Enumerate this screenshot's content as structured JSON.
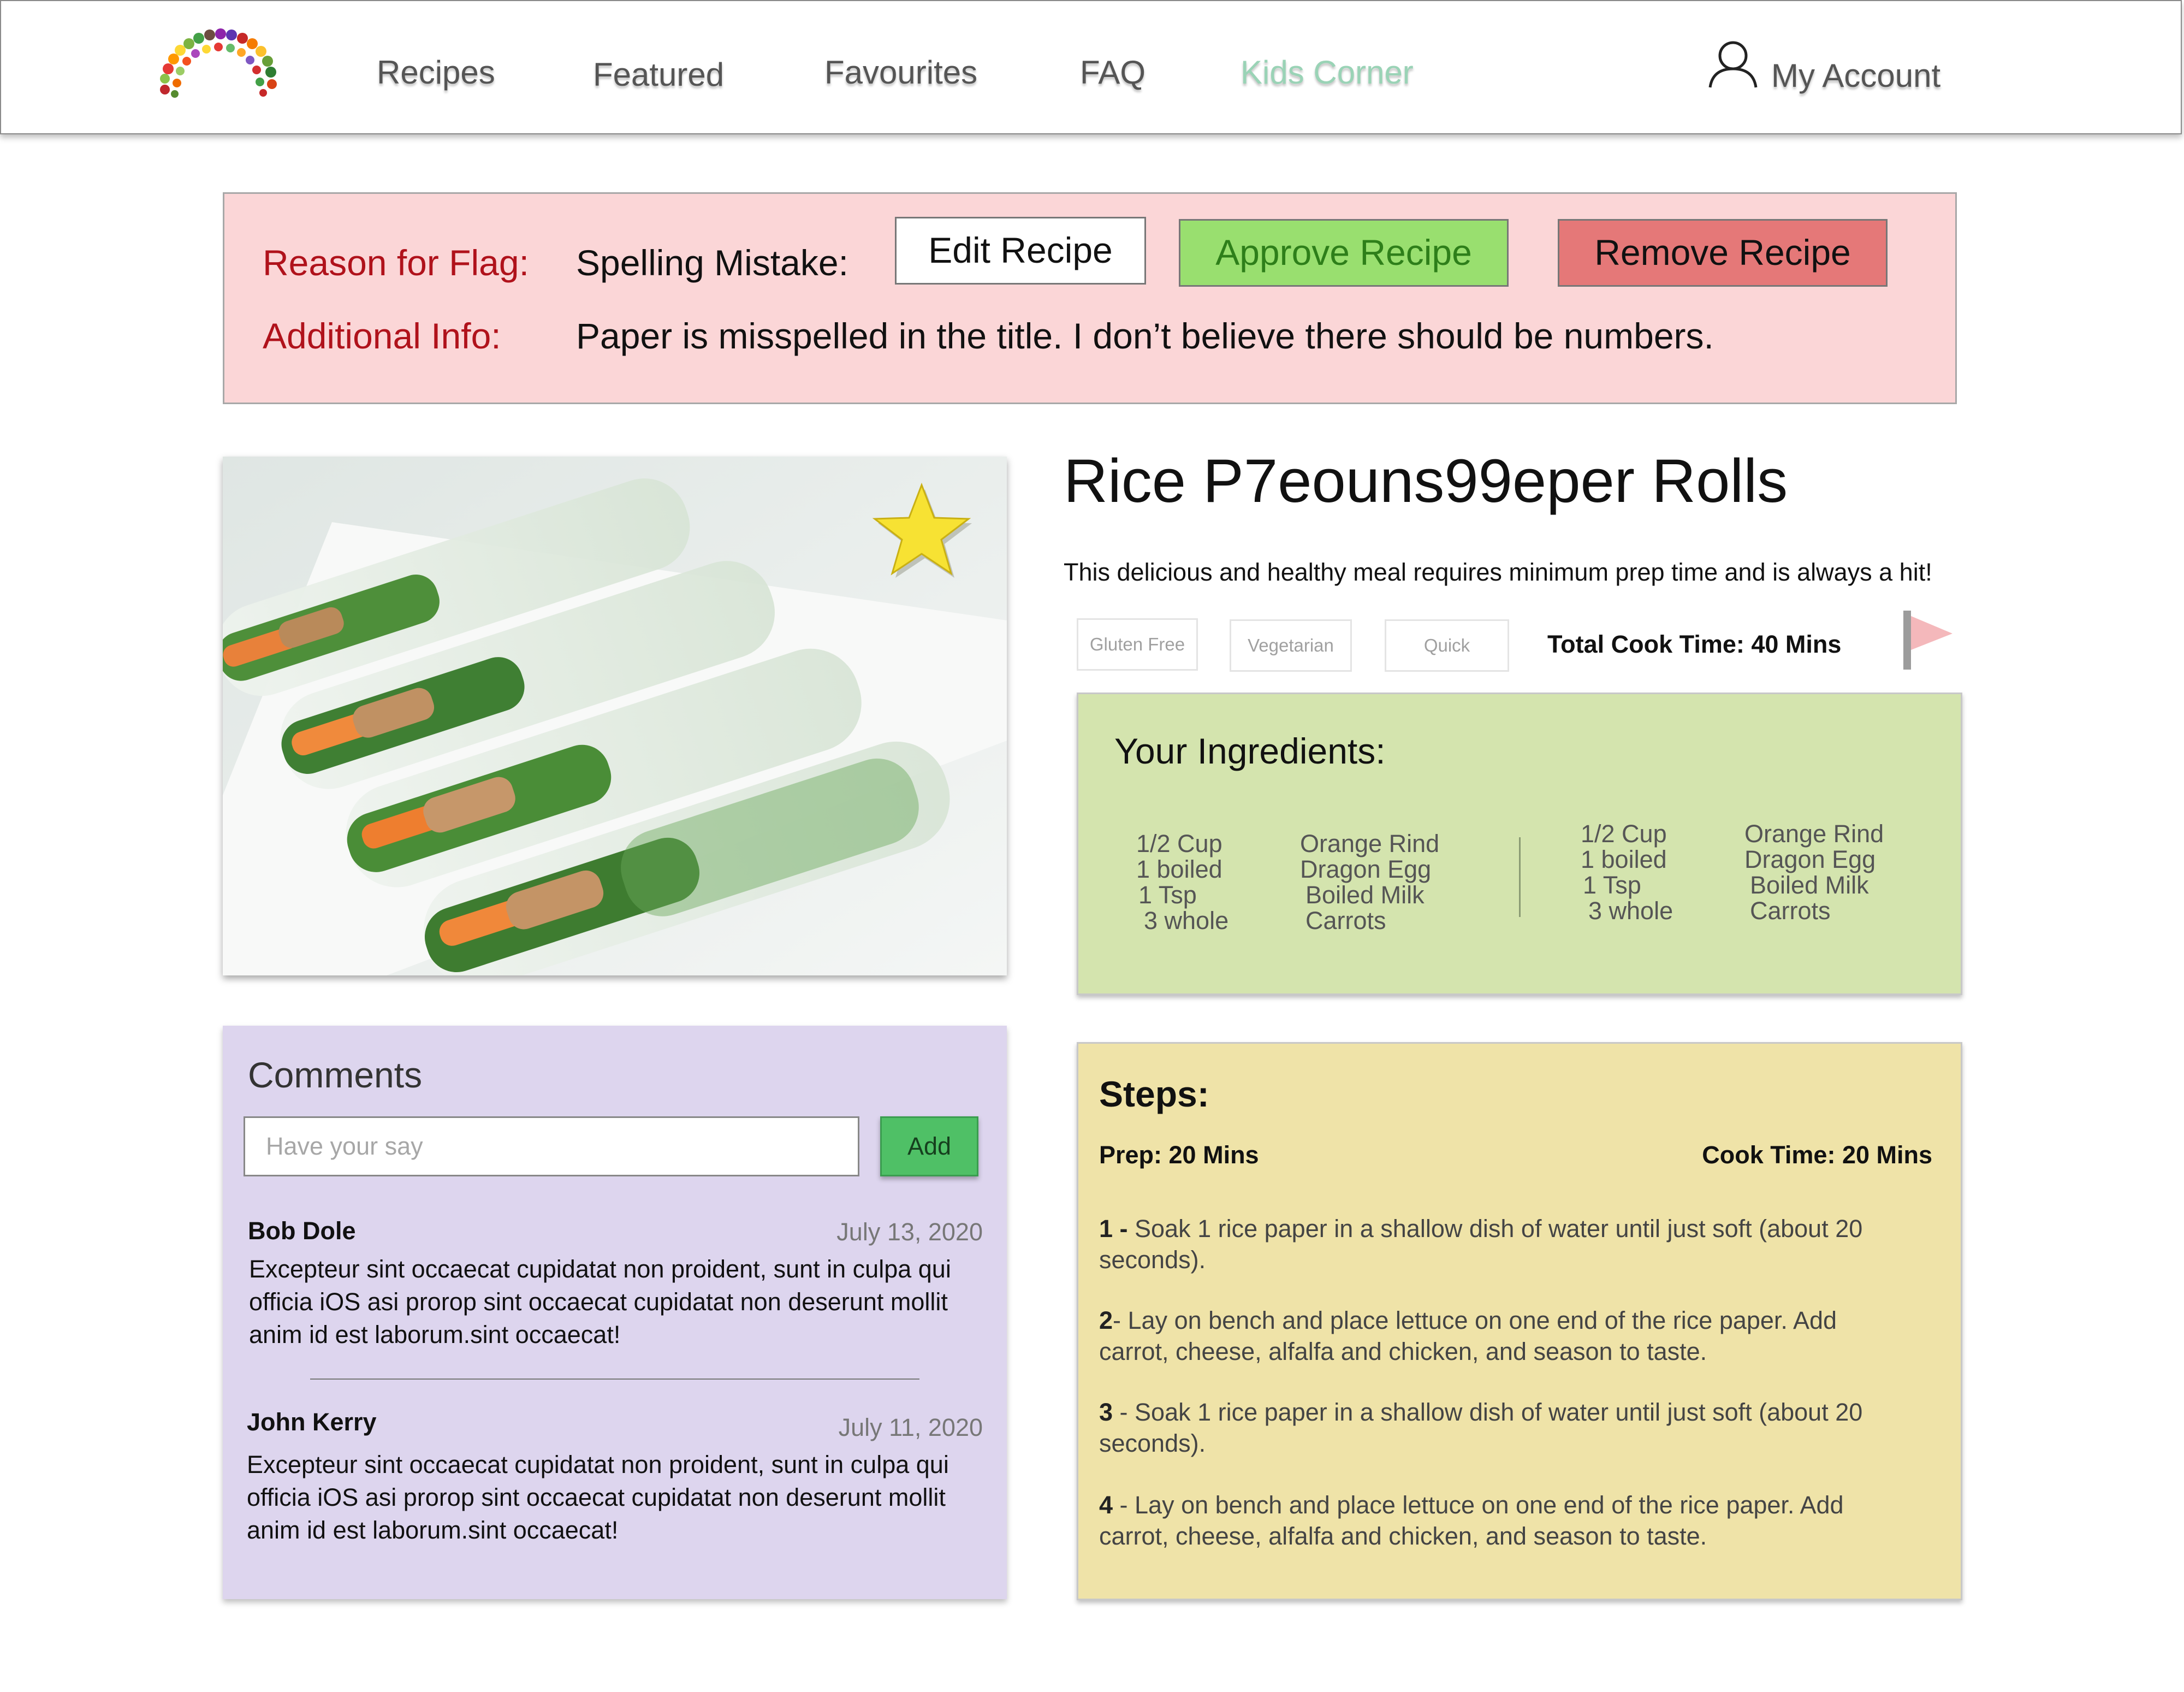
{
  "nav": {
    "links": [
      "Recipes",
      "Featured",
      "Favourites",
      "FAQ",
      "Kids Corner"
    ],
    "account_label": "My Account"
  },
  "flag": {
    "reason_label": "Reason for Flag:",
    "reason_value": "Spelling Mistake:",
    "info_label": "Additional Info:",
    "info_value": "Paper is misspelled in the title. I don’t believe there should be numbers.",
    "edit_label": "Edit Recipe",
    "approve_label": "Approve Recipe",
    "remove_label": "Remove Recipe"
  },
  "recipe": {
    "title": "Rice P7eouns99eper Rolls",
    "description": "This delicious and healthy meal requires minimum prep time and is always a hit!",
    "tags": [
      "Gluten Free",
      "Vegetarian",
      "Quick"
    ],
    "total_cook_time": "Total Cook Time: 40 Mins"
  },
  "ingredients": {
    "heading": "Your Ingredients:",
    "left": {
      "amounts": [
        "1/2 Cup",
        "1 boiled",
        "1 Tsp",
        "3 whole"
      ],
      "items": [
        "Orange Rind",
        "Dragon Egg",
        "Boiled Milk",
        "Carrots"
      ]
    },
    "right": {
      "amounts": [
        "1/2 Cup",
        "1 boiled",
        "1 Tsp",
        "3 whole"
      ],
      "items": [
        "Orange Rind",
        "Dragon Egg",
        "Boiled Milk",
        "Carrots"
      ]
    }
  },
  "comments": {
    "heading": "Comments",
    "placeholder": "Have your say",
    "add_label": "Add",
    "items": [
      {
        "author": "Bob Dole",
        "date": "July 13, 2020",
        "body": "Excepteur sint occaecat cupidatat non proident, sunt in culpa qui officia iOS asi prorop sint occaecat cupidatat non deserunt mollit anim id est laborum.sint occaecat!"
      },
      {
        "author": "John Kerry",
        "date": "July 11, 2020",
        "body": "Excepteur sint occaecat cupidatat non proident, sunt in culpa qui officia iOS asi prorop sint occaecat cupidatat non deserunt mollit anim id est laborum.sint occaecat!"
      }
    ]
  },
  "steps": {
    "heading": "Steps:",
    "prep": "Prep: 20 Mins",
    "cook": "Cook Time: 20 Mins",
    "items": [
      {
        "num": "1 -",
        "text": " Soak 1 rice paper in a shallow dish of water until just soft (about 20 seconds)."
      },
      {
        "num": "2",
        "text": "- Lay on bench and place lettuce on one end of the rice paper. Add carrot, cheese, alfalfa and chicken, and season to taste."
      },
      {
        "num": "3",
        "text": " - Soak 1 rice paper in a shallow dish of water until just soft (about 20 seconds)."
      },
      {
        "num": "4",
        "text": " - Lay on bench and place lettuce on one end of the rice paper. Add carrot, cheese, alfalfa and chicken, and season to taste."
      }
    ]
  },
  "colors": {
    "flag_panel": "#fbd6d7",
    "flag_label": "#b0121b",
    "approve": "#99df6f",
    "remove": "#e57878",
    "ingredients_panel": "#d4e4ae",
    "comments_panel": "#ddd5ee",
    "steps_panel": "#efe3a8",
    "kids_corner": "#9ad3b6",
    "add_button": "#4fc066"
  },
  "icons": {
    "logo": "fruit-rainbow-logo",
    "account": "user-icon",
    "favourite": "star-icon",
    "report": "flag-icon"
  }
}
